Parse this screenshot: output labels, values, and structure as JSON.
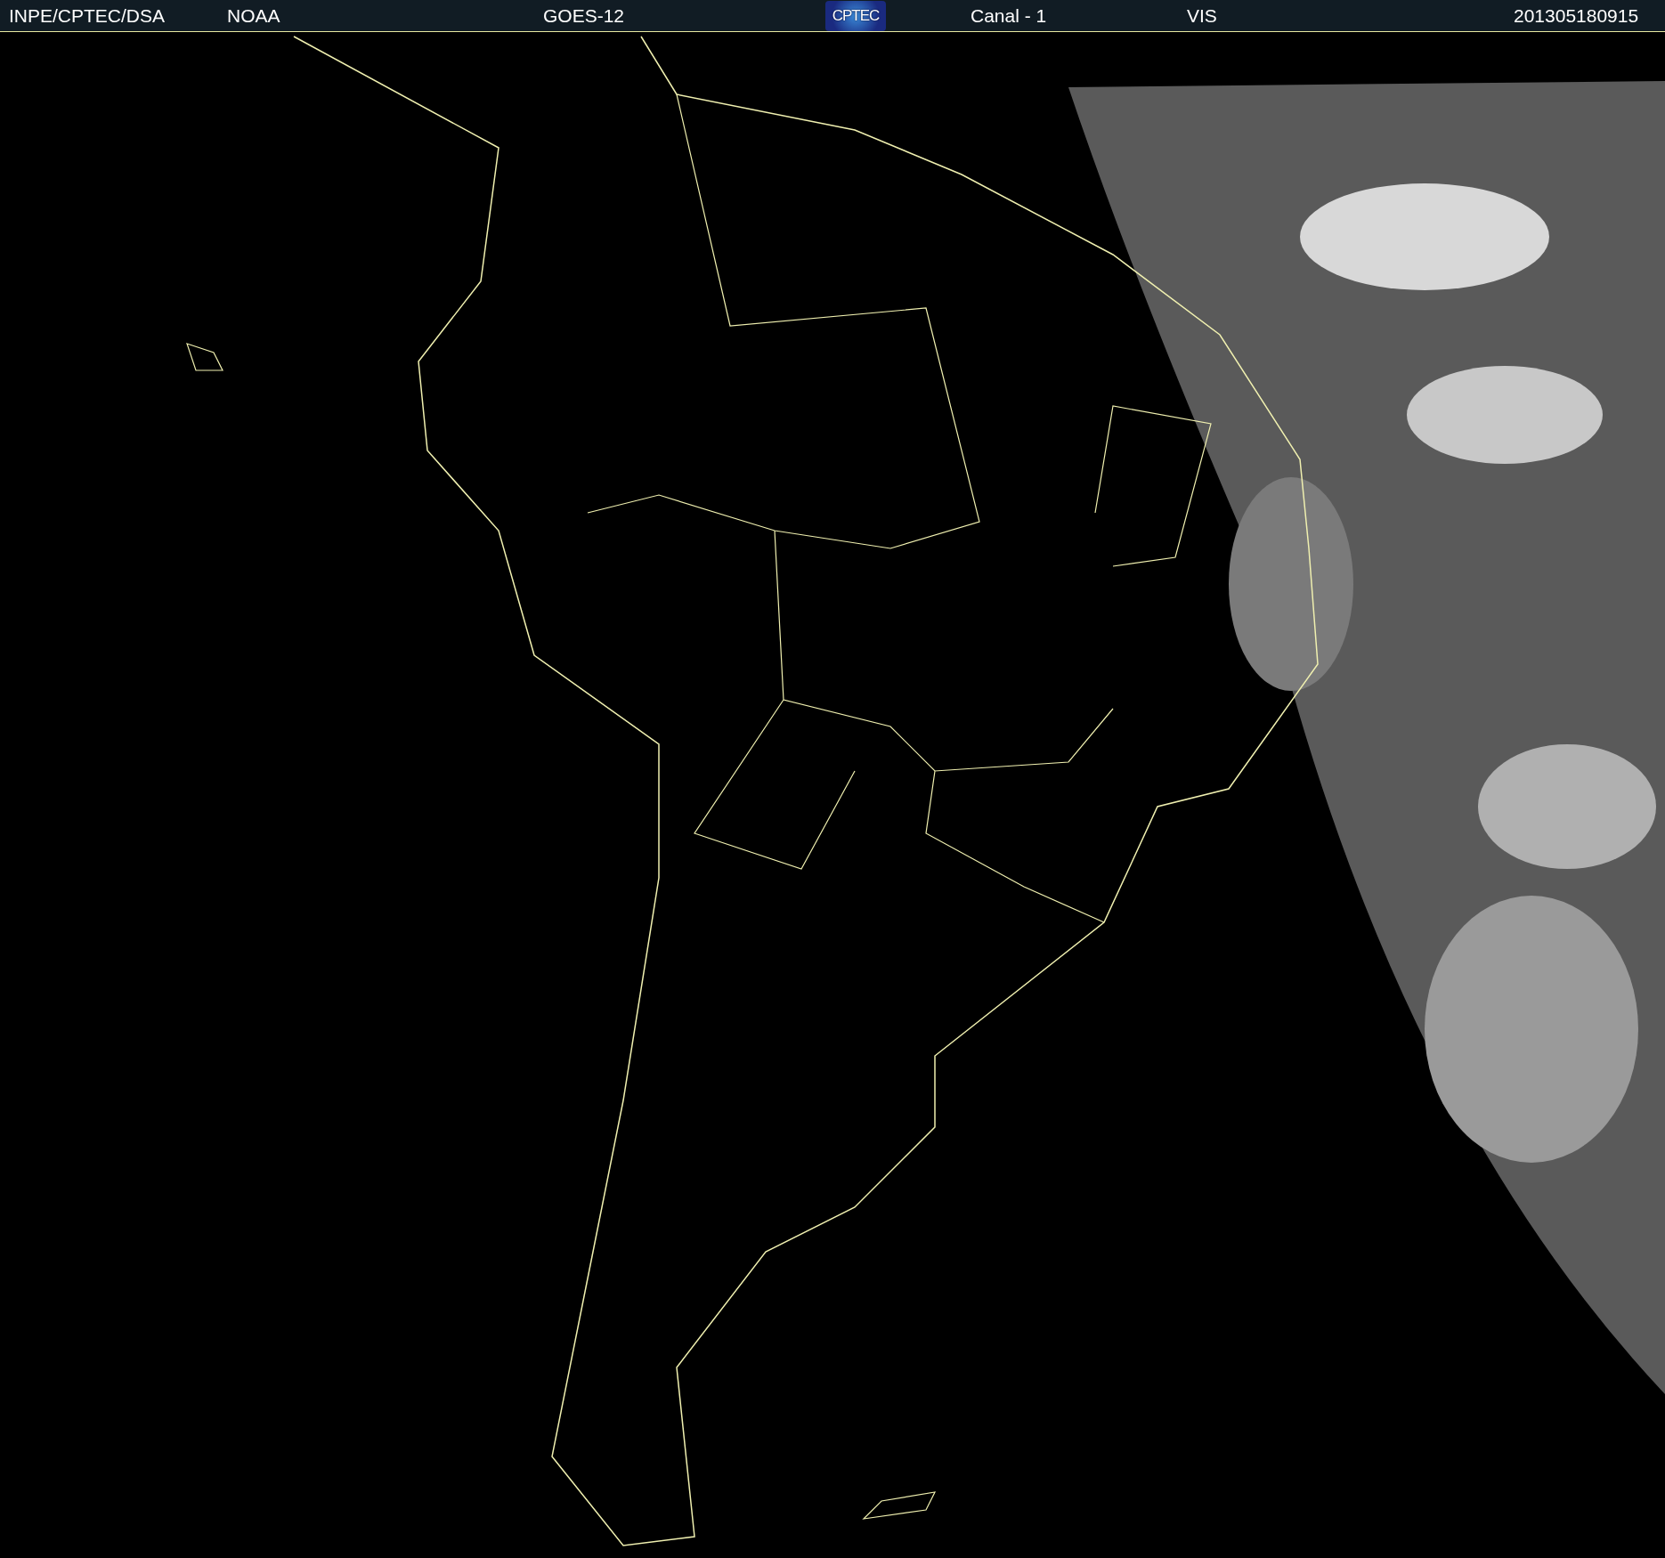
{
  "header": {
    "items": [
      {
        "kind": "text",
        "text": "INPE/CPTEC/DSA"
      },
      {
        "kind": "text",
        "text": "NOAA"
      },
      {
        "kind": "text",
        "text": "GOES-12"
      },
      {
        "kind": "logo",
        "text": "CPTEC"
      },
      {
        "kind": "text",
        "text": "Canal - 1"
      },
      {
        "kind": "text",
        "text": "VIS"
      },
      {
        "kind": "text",
        "text": "201305180915"
      }
    ]
  }
}
